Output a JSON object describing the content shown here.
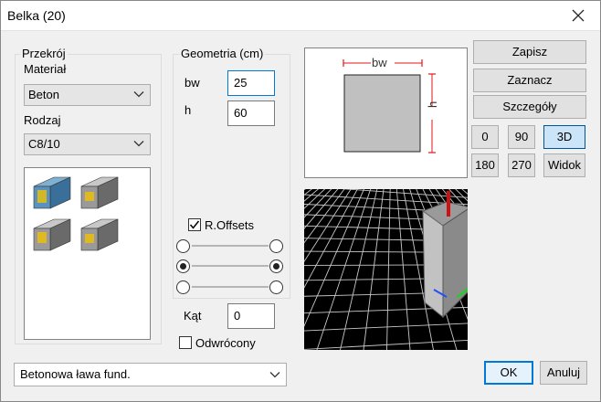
{
  "window": {
    "title": "Belka (20)"
  },
  "przekroj": {
    "legend": "Przekrój",
    "material_label": "Materiał",
    "material_value": "Beton",
    "rodzaj_label": "Rodzaj",
    "rodzaj_value": "C8/10"
  },
  "geometria": {
    "legend": "Geometria (cm)",
    "bw_label": "bw",
    "bw_value": "25",
    "h_label": "h",
    "h_value": "60",
    "offsets_label": "R.Offsets",
    "offsets_checked": true
  },
  "kat": {
    "label": "Kąt",
    "value": "0"
  },
  "odwrocony": {
    "label": "Odwrócony",
    "checked": false
  },
  "profile": {
    "value": "Betonowa ława fund."
  },
  "preview": {
    "bw_label": "bw",
    "h_label": "h"
  },
  "buttons": {
    "zapisz": "Zapisz",
    "zaznacz": "Zaznacz",
    "szczegoly": "Szczegóły",
    "v0": "0",
    "v90": "90",
    "v3d": "3D",
    "v180": "180",
    "v270": "270",
    "widok": "Widok",
    "ok": "OK",
    "anuluj": "Anuluj"
  },
  "colors": {
    "accent": "#0078d7",
    "dim_red": "#e0151b",
    "beam_gray": "#b4b4b4",
    "grid_bg": "#000000"
  }
}
